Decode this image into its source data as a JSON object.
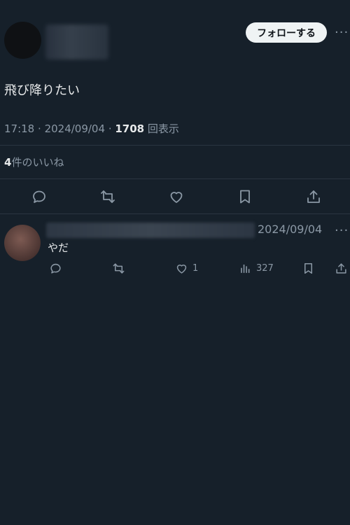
{
  "post": {
    "follow_label": "フォローする",
    "more_glyph": "···",
    "text": "飛び降りたい",
    "time": "17:18",
    "date": "2024/09/04",
    "views_count": "1708",
    "views_label": "回表示",
    "likes_count": "4",
    "likes_label": "件のいいね"
  },
  "reply": {
    "date": "2024/09/04",
    "more_glyph": "···",
    "text": "やだ",
    "like_count": "1",
    "view_count": "327"
  },
  "icons": {
    "main_actions": [
      "reply-icon",
      "retweet-icon",
      "like-icon",
      "bookmark-icon",
      "share-icon"
    ],
    "reply_actions": [
      "reply-icon",
      "retweet-icon",
      "like-icon",
      "views-icon",
      "bookmark-icon",
      "share-icon"
    ]
  },
  "colors": {
    "background": "#16202a",
    "text": "#e7e9ea",
    "muted": "#8b98a5",
    "divider": "#2a3541",
    "follow_button_bg": "#eff3f4"
  }
}
